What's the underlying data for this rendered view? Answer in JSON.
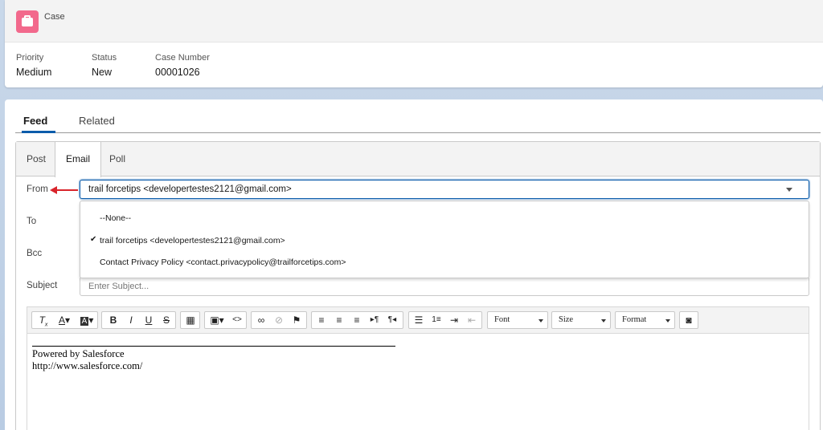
{
  "header": {
    "object_label": "Case",
    "fields": [
      {
        "label": "Priority",
        "value": "Medium"
      },
      {
        "label": "Status",
        "value": "New"
      },
      {
        "label": "Case Number",
        "value": "00001026"
      }
    ]
  },
  "feed_tabs": [
    "Feed",
    "Related"
  ],
  "publisher": {
    "tabs": [
      "Post",
      "Email",
      "Poll"
    ],
    "from_label": "From",
    "from_value": "trail forcetips <developertestes2121@gmail.com>",
    "options": [
      "--None--",
      "trail forcetips <developertestes2121@gmail.com>",
      "Contact Privacy Policy <contact.privacypolicy@trailforcetips.com>"
    ],
    "to_label": "To",
    "bcc_label": "Bcc",
    "subject_label": "Subject",
    "subject_placeholder": "Enter Subject..."
  },
  "toolbar": {
    "font_label": "Font",
    "size_label": "Size",
    "format_label": "Format"
  },
  "signature": {
    "line1": "Powered by Salesforce",
    "line2": "http://www.salesforce.com/"
  },
  "colors": {
    "accent": "#0b5cab",
    "case_icon": "#f2698c",
    "annotation_arrow": "#d9242b"
  }
}
